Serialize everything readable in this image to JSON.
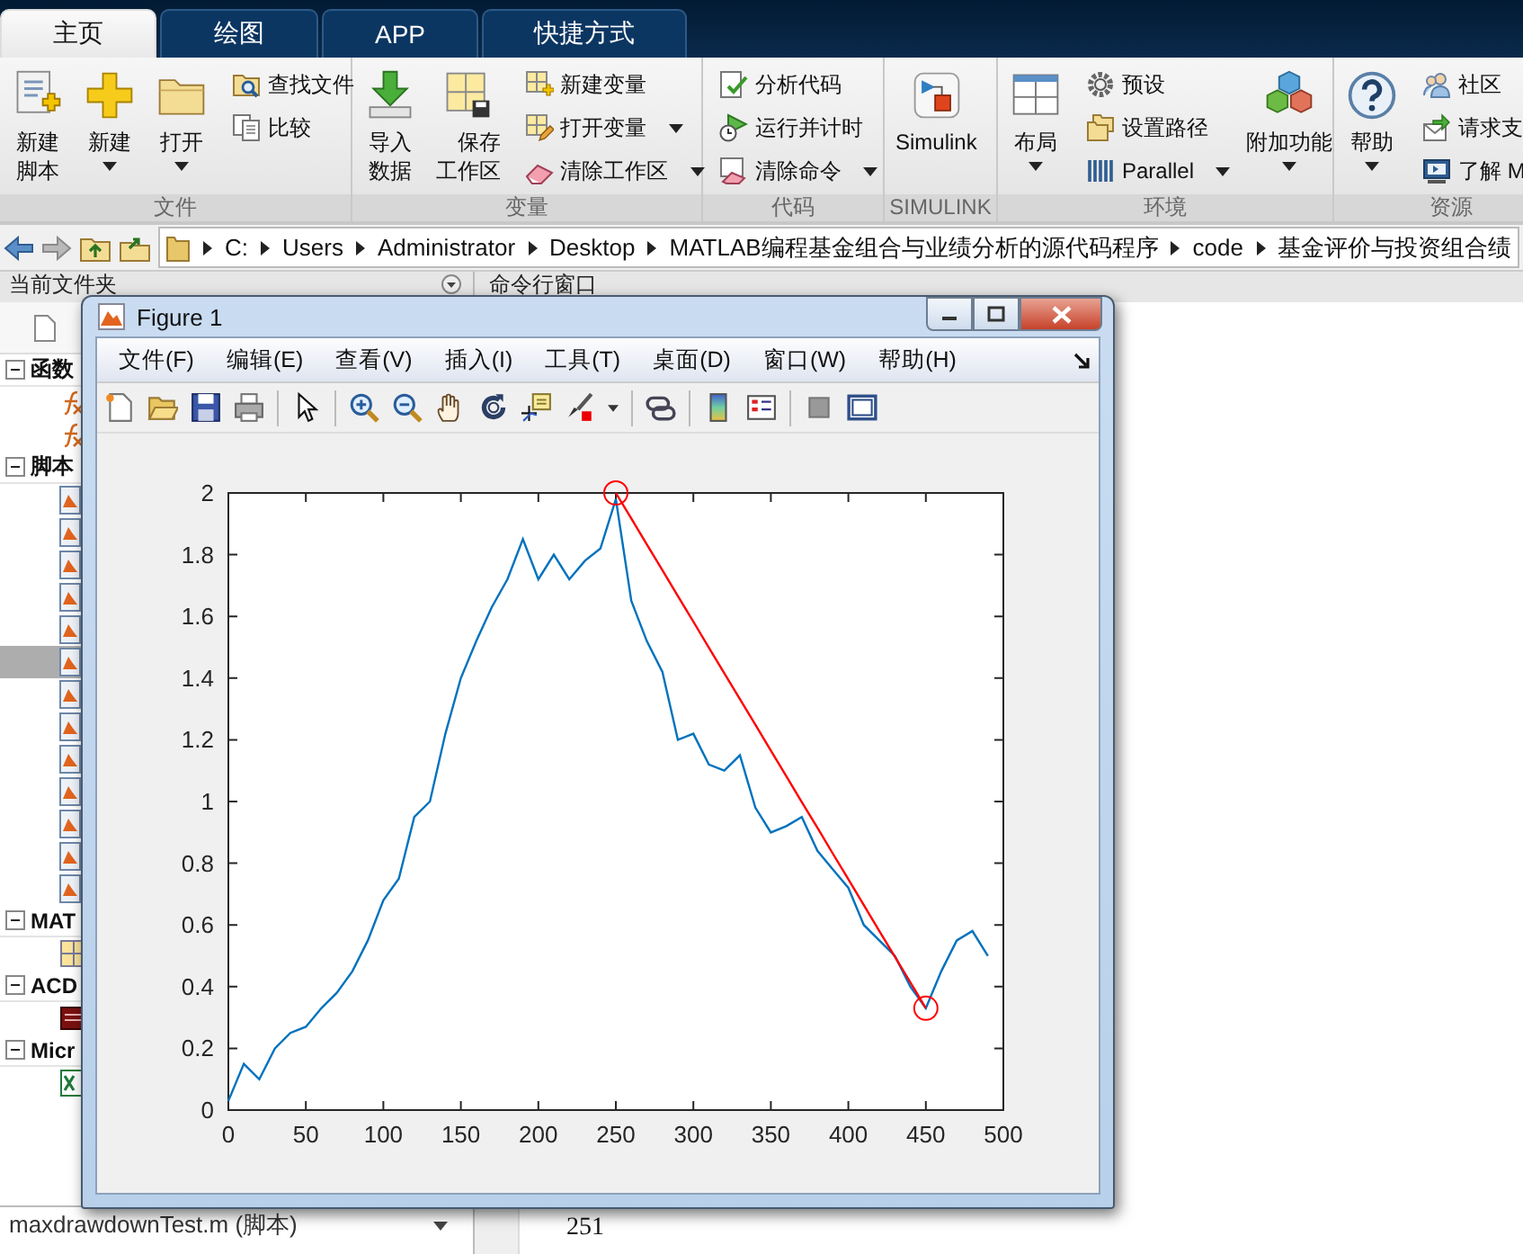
{
  "tabs": [
    {
      "label": "主页",
      "selected": true
    },
    {
      "label": "绘图",
      "selected": false
    },
    {
      "label": "APP",
      "selected": false
    },
    {
      "label": "快捷方式",
      "selected": false
    }
  ],
  "ribbon": [
    {
      "label": "文件",
      "items": [
        {
          "kind": "big",
          "label": "新建脚本",
          "dropdown": false
        },
        {
          "kind": "big",
          "label": "新建",
          "dropdown": true
        },
        {
          "kind": "big",
          "label": "打开",
          "dropdown": true
        },
        {
          "kind": "small",
          "label": "查找文件",
          "dropdown": false
        },
        {
          "kind": "small",
          "label": "比较",
          "dropdown": false
        }
      ]
    },
    {
      "label": "变量",
      "items": [
        {
          "kind": "big",
          "label": "导入数据",
          "dropdown": false
        },
        {
          "kind": "big",
          "label": "保存工作区",
          "dropdown": false
        },
        {
          "kind": "small",
          "label": "新建变量",
          "dropdown": false
        },
        {
          "kind": "small",
          "label": "打开变量",
          "dropdown": true
        },
        {
          "kind": "small",
          "label": "清除工作区",
          "dropdown": true
        }
      ]
    },
    {
      "label": "代码",
      "items": [
        {
          "kind": "small",
          "label": "分析代码",
          "dropdown": false
        },
        {
          "kind": "small",
          "label": "运行并计时",
          "dropdown": false
        },
        {
          "kind": "small",
          "label": "清除命令",
          "dropdown": true
        }
      ]
    },
    {
      "label": "SIMULINK",
      "items": [
        {
          "kind": "big",
          "label": "Simulink",
          "dropdown": false
        }
      ]
    },
    {
      "label": "环境",
      "items": [
        {
          "kind": "big",
          "label": "布局",
          "dropdown": true
        },
        {
          "kind": "small",
          "label": "预设",
          "dropdown": false
        },
        {
          "kind": "small",
          "label": "设置路径",
          "dropdown": false
        },
        {
          "kind": "small",
          "label": "Parallel",
          "dropdown": true
        },
        {
          "kind": "big",
          "label": "附加功能",
          "dropdown": true
        }
      ]
    },
    {
      "label": "资源",
      "items": [
        {
          "kind": "big",
          "label": "帮助",
          "dropdown": true
        },
        {
          "kind": "small",
          "label": "社区",
          "dropdown": false
        },
        {
          "kind": "small",
          "label": "请求支",
          "dropdown": false
        },
        {
          "kind": "small",
          "label": "了解 M",
          "dropdown": false
        }
      ]
    }
  ],
  "address_bar": {
    "path": [
      "C:",
      "Users",
      "Administrator",
      "Desktop",
      "MATLAB编程基金组合与业绩分析的源代码程序",
      "code",
      "基金评价与投资组合绩"
    ]
  },
  "current_folder": {
    "title": "当前文件夹",
    "groups": [
      {
        "label": "函数",
        "expanded": true,
        "children": [
          {
            "kind": "function",
            "selected": false
          },
          {
            "kind": "function",
            "selected": false
          }
        ]
      },
      {
        "label": "脚本",
        "expanded": true,
        "children": [
          {
            "kind": "script",
            "selected": false
          },
          {
            "kind": "script",
            "selected": false
          },
          {
            "kind": "script",
            "selected": false
          },
          {
            "kind": "script",
            "selected": false
          },
          {
            "kind": "script",
            "selected": false
          },
          {
            "kind": "script",
            "selected": true
          },
          {
            "kind": "script",
            "selected": false
          },
          {
            "kind": "script",
            "selected": false
          },
          {
            "kind": "script",
            "selected": false
          },
          {
            "kind": "script",
            "selected": false
          },
          {
            "kind": "script",
            "selected": false
          },
          {
            "kind": "script",
            "selected": false
          },
          {
            "kind": "script",
            "selected": false
          }
        ]
      },
      {
        "label": "MAT",
        "expanded": true,
        "children": [
          {
            "kind": "data",
            "selected": false
          }
        ]
      },
      {
        "label": "ACD",
        "expanded": true,
        "children": [
          {
            "kind": "image",
            "selected": false
          }
        ]
      },
      {
        "label": "Micr",
        "expanded": true,
        "children": [
          {
            "kind": "excel",
            "selected": false
          }
        ]
      }
    ],
    "details": "maxdrawdownTest.m  (脚本)"
  },
  "command_window": {
    "title": "命令行窗口",
    "lines": [
      "251"
    ]
  },
  "figure": {
    "title": "Figure 1",
    "menu": [
      "文件(F)",
      "编辑(E)",
      "查看(V)",
      "插入(I)",
      "工具(T)",
      "桌面(D)",
      "窗口(W)",
      "帮助(H)"
    ],
    "chart_data": {
      "type": "line",
      "xlim": [
        0,
        500
      ],
      "ylim": [
        0,
        2
      ],
      "xticks": [
        0,
        50,
        100,
        150,
        200,
        250,
        300,
        350,
        400,
        450,
        500
      ],
      "yticks": [
        0,
        0.2,
        0.4,
        0.6,
        0.8,
        1,
        1.2,
        1.4,
        1.6,
        1.8,
        2
      ],
      "x": [
        0,
        10,
        20,
        30,
        40,
        50,
        60,
        70,
        80,
        90,
        100,
        110,
        120,
        130,
        140,
        150,
        160,
        170,
        180,
        190,
        200,
        210,
        220,
        230,
        240,
        250,
        260,
        270,
        280,
        290,
        300,
        310,
        320,
        330,
        340,
        350,
        360,
        370,
        380,
        390,
        400,
        410,
        420,
        430,
        440,
        450,
        460,
        470,
        480,
        490
      ],
      "series": [
        {
          "color": "#0072bd",
          "values": [
            0.03,
            0.15,
            0.1,
            0.2,
            0.25,
            0.27,
            0.33,
            0.38,
            0.45,
            0.55,
            0.68,
            0.75,
            0.95,
            1.0,
            1.22,
            1.4,
            1.52,
            1.63,
            1.72,
            1.85,
            1.72,
            1.8,
            1.72,
            1.78,
            1.82,
            1.98,
            1.65,
            1.52,
            1.42,
            1.2,
            1.22,
            1.12,
            1.1,
            1.15,
            0.98,
            0.9,
            0.92,
            0.95,
            0.84,
            0.78,
            0.72,
            0.6,
            0.55,
            0.5,
            0.4,
            0.33,
            0.45,
            0.55,
            0.58,
            0.5
          ]
        },
        {
          "color": "#ff0000",
          "values": [
            null,
            null,
            null,
            null,
            null,
            null,
            null,
            null,
            null,
            null,
            null,
            null,
            null,
            null,
            null,
            null,
            null,
            null,
            null,
            null,
            null,
            null,
            null,
            null,
            null,
            2,
            1.917,
            1.833,
            1.75,
            1.666,
            1.583,
            1.499,
            1.416,
            1.332,
            1.249,
            1.165,
            1.082,
            0.998,
            0.915,
            0.831,
            0.748,
            0.664,
            0.581,
            0.497,
            0.414,
            0.33,
            null,
            null,
            null,
            null
          ]
        },
        {
          "color": "#ff0000",
          "values": [
            null,
            null,
            null,
            null,
            null,
            null,
            null,
            null,
            null,
            null,
            null,
            null,
            null,
            null,
            null,
            null,
            null,
            null,
            null,
            null,
            null,
            null,
            null,
            null,
            null,
            2,
            null,
            null,
            null,
            null,
            null,
            null,
            null,
            null,
            null,
            null,
            null,
            null,
            null,
            null,
            null,
            null,
            null,
            null,
            null,
            0.33,
            null,
            null,
            null,
            null
          ]
        }
      ]
    }
  }
}
